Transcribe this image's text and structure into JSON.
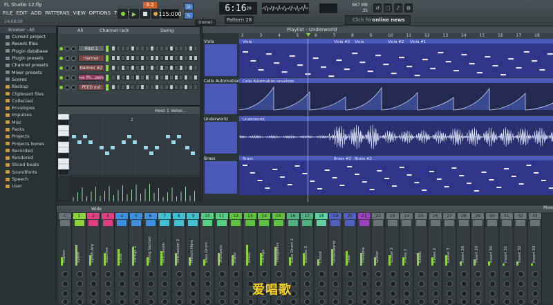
{
  "app": {
    "title": "FL Studio 12.flp",
    "menu": [
      "FILE",
      "EDIT",
      "ADD",
      "PATTERNS",
      "VIEW",
      "OPTIONS",
      "TOOLS",
      "?"
    ],
    "hint": "14:08:09",
    "tempo": "115.000",
    "time": "6:16",
    "time_sub": "20",
    "pattern": "Pattern 28",
    "pattern_mode": "(none)",
    "cpu_mem": "667 MB",
    "cpu_val": "35",
    "cpu_num": "3",
    "news_prefix": "Click for ",
    "news_label": "online news"
  },
  "browser": {
    "header": "Browser - All",
    "items": [
      {
        "label": "Current project",
        "icon": "folder-icon"
      },
      {
        "label": "Recent files",
        "icon": "folder-icon"
      },
      {
        "label": "Plugin database",
        "icon": "folder-icon"
      },
      {
        "label": "Plugin presets",
        "icon": "folder-icon"
      },
      {
        "label": "Channel presets",
        "icon": "folder-icon"
      },
      {
        "label": "Mixer presets",
        "icon": "folder-icon"
      },
      {
        "label": "Scores",
        "icon": "folder-icon"
      },
      {
        "label": "Backup",
        "icon": "folder-icon"
      },
      {
        "label": "Clipboard files",
        "icon": "folder-icon"
      },
      {
        "label": "Collected",
        "icon": "folder-icon"
      },
      {
        "label": "Envelopes",
        "icon": "folder-icon"
      },
      {
        "label": "Impulses",
        "icon": "folder-icon"
      },
      {
        "label": "Misc",
        "icon": "folder-icon"
      },
      {
        "label": "Packs",
        "icon": "folder-icon"
      },
      {
        "label": "Projects",
        "icon": "folder-icon"
      },
      {
        "label": "Projects bones",
        "icon": "folder-icon"
      },
      {
        "label": "Recorded",
        "icon": "folder-icon"
      },
      {
        "label": "Rendered",
        "icon": "folder-icon"
      },
      {
        "label": "Sliced beats",
        "icon": "folder-icon"
      },
      {
        "label": "Soundfonts",
        "icon": "folder-icon"
      },
      {
        "label": "Speech",
        "icon": "folder-icon"
      },
      {
        "label": "User",
        "icon": "folder-icon"
      }
    ]
  },
  "channel_rack": {
    "filter": "All",
    "header": "Channel rack",
    "swing_label": "Swing",
    "channels": [
      {
        "name": "Host 1",
        "color": "#5d666b"
      },
      {
        "name": "Harmor",
        "color": "#7a4848"
      },
      {
        "name": "Harmor #2",
        "color": "#7a4848"
      },
      {
        "name": "Love Ph...aency",
        "color": "#8a3a5a"
      },
      {
        "name": "PEED out",
        "color": "#7a4848"
      }
    ]
  },
  "piano_roll": {
    "header": "Host 1  Veloc..",
    "bar_label": "2"
  },
  "playlist": {
    "header": "Playlist - Underworld",
    "bars": [
      "2",
      "3",
      "4",
      "5",
      "6",
      "7",
      "8",
      "9",
      "10",
      "11",
      "12",
      "13",
      "14",
      "15",
      "16",
      "17",
      "18",
      "19"
    ],
    "tracks": [
      {
        "name": "Viola",
        "clip": "Viola",
        "clips": [
          "Viola",
          "Viola #2",
          "Viola",
          "Viola #2",
          "Viola #1"
        ]
      },
      {
        "name": "Cello Automation",
        "clip": "Cello Automation envelope"
      },
      {
        "name": "Underworld",
        "clip": "Underworld"
      },
      {
        "name": "Brass",
        "clip": "Brass",
        "clips": [
          "Brass",
          "Brass #2",
          "Brass #2"
        ]
      }
    ]
  },
  "mixer": {
    "header": "Wide",
    "right_label": "Mixer",
    "channels": [
      {
        "num": "C",
        "name": "Master",
        "color": "#6a7378"
      },
      {
        "num": "1",
        "name": "Synth",
        "color": "#8cd43c"
      },
      {
        "num": "2",
        "name": "Synth Arp",
        "color": "#e04080"
      },
      {
        "num": "3",
        "name": "Additive",
        "color": "#e04080"
      },
      {
        "num": "4",
        "name": "Cello",
        "color": "#4090e0"
      },
      {
        "num": "5",
        "name": "Strings 2",
        "color": "#4090e0"
      },
      {
        "num": "6",
        "name": "String Section",
        "color": "#4090e0"
      },
      {
        "num": "7",
        "name": "Percussion",
        "color": "#40c0d0"
      },
      {
        "num": "8",
        "name": "Percussion 2",
        "color": "#40c0d0"
      },
      {
        "num": "9",
        "name": "French Horn",
        "color": "#40c0d0"
      },
      {
        "num": "10",
        "name": "Bass Drum",
        "color": "#50d080"
      },
      {
        "num": "11",
        "name": "Trumpets",
        "color": "#50d080"
      },
      {
        "num": "12",
        "name": "Piano",
        "color": "#60c040"
      },
      {
        "num": "13",
        "name": "Brass",
        "color": "#60c040"
      },
      {
        "num": "14",
        "name": "Strings",
        "color": "#60c040"
      },
      {
        "num": "15",
        "name": "Thinginess",
        "color": "#60c040"
      },
      {
        "num": "16",
        "name": "Bass Drum 2",
        "color": "#50b080"
      },
      {
        "num": "17",
        "name": "Basses 2",
        "color": "#50b080"
      },
      {
        "num": "18",
        "name": "Chord",
        "color": "#60d0a0"
      },
      {
        "num": "19",
        "name": "Underworld",
        "color": "#5060c0"
      },
      {
        "num": "20",
        "name": "Saw",
        "color": "#5060c0"
      },
      {
        "num": "21",
        "name": "Invisible",
        "color": "#9a40c0"
      },
      {
        "num": "22",
        "name": "Guitar",
        "color": "#6a7378"
      },
      {
        "num": "23",
        "name": "Guitar 2",
        "color": "#6a7378"
      },
      {
        "num": "24",
        "name": "Piano 2",
        "color": "#6a7378"
      },
      {
        "num": "25",
        "name": "Kawai",
        "color": "#6a7378"
      },
      {
        "num": "26",
        "name": "Kawai 2",
        "color": "#6a7378"
      },
      {
        "num": "27",
        "name": "Kawai 3",
        "color": "#6a7378"
      },
      {
        "num": "28",
        "name": "Insert 28",
        "color": "#6a7378"
      },
      {
        "num": "29",
        "name": "Insert 29",
        "color": "#6a7378"
      },
      {
        "num": "30",
        "name": "Insert 30",
        "color": "#6a7378"
      },
      {
        "num": "31",
        "name": "Insert 31",
        "color": "#6a7378"
      },
      {
        "num": "32",
        "name": "Insert 32",
        "color": "#6a7378"
      },
      {
        "num": "33",
        "name": "Insert 33",
        "color": "#6a7378"
      }
    ],
    "levels": [
      0.2,
      0.5,
      0.25,
      0.3,
      0.4,
      0.45,
      0.2,
      0.35,
      0.3,
      0.2,
      0.15,
      0.3,
      0.25,
      0.5,
      0.3,
      0.45,
      0.2,
      0.3,
      0.15,
      0.4,
      0.35,
      0.3,
      0.2,
      0.25,
      0.2,
      0.3,
      0.2,
      0.25,
      0.1,
      0.15,
      0.1,
      0.05,
      0.1,
      0.05
    ]
  },
  "watermark": "爱唱歌"
}
